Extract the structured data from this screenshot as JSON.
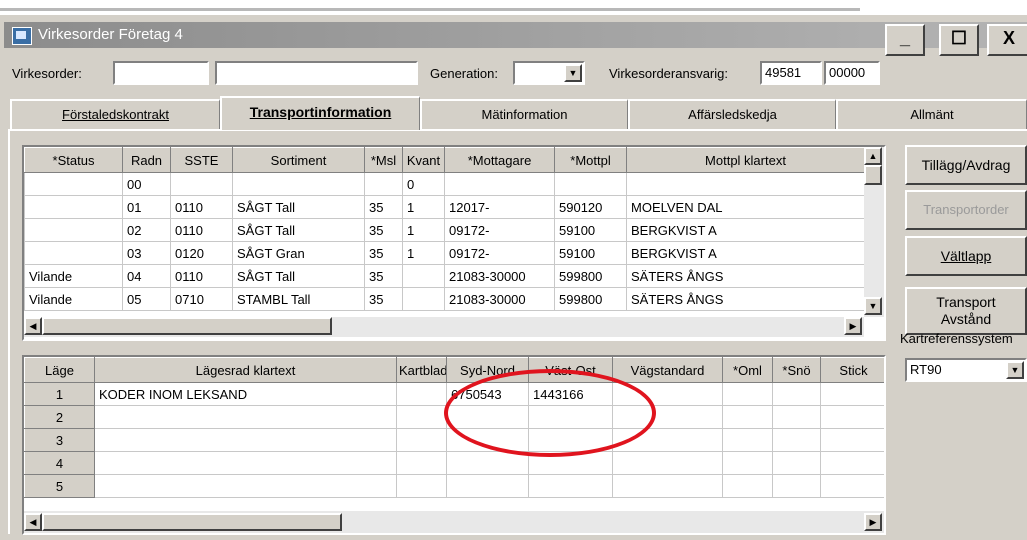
{
  "window": {
    "title": "Virkesorder Företag 4",
    "minimize_label": "_",
    "maximize_label": "☐",
    "close_label": "X"
  },
  "header": {
    "virkesorder_label": "Virkesorder:",
    "virkesorder_value1": "",
    "virkesorder_value2": "",
    "generation_label": "Generation:",
    "generation_value": "",
    "ansvarig_label": "Virkesorderansvarig:",
    "ansvarig_value1": "49581",
    "ansvarig_value2": "00000"
  },
  "tabs": [
    {
      "label": "Förstaledskontrakt"
    },
    {
      "label": "Transportinformation"
    },
    {
      "label": "Mätinformation"
    },
    {
      "label": "Affärsledskedja"
    },
    {
      "label": "Allmänt"
    }
  ],
  "upper_table": {
    "columns": [
      "*Status",
      "Radn",
      "SSTE",
      "Sortiment",
      "*Msl",
      "Kvant",
      "*Mottagare",
      "*Mottpl",
      "Mottpl klartext"
    ],
    "rows": [
      [
        "",
        "00",
        "",
        "",
        "",
        "0",
        "",
        "",
        ""
      ],
      [
        "",
        "01",
        "0110",
        "SÅGT Tall",
        "35",
        "1",
        "12017-",
        "590120",
        "MOELVEN DAL"
      ],
      [
        "",
        "02",
        "0110",
        "SÅGT Tall",
        "35",
        "1",
        "09172-",
        "59100",
        "BERGKVIST A"
      ],
      [
        "",
        "03",
        "0120",
        "SÅGT Gran",
        "35",
        "1",
        "09172-",
        "59100",
        "BERGKVIST A"
      ],
      [
        "Vilande",
        "04",
        "0110",
        "SÅGT Tall",
        "35",
        "",
        "21083-30000",
        "599800",
        "SÄTERS ÅNGS"
      ],
      [
        "Vilande",
        "05",
        "0710",
        "STAMBL Tall",
        "35",
        "",
        "21083-30000",
        "599800",
        "SÄTERS ÅNGS"
      ]
    ]
  },
  "lower_table": {
    "columns": [
      "Läge",
      "Lägesrad klartext",
      "Kartblad",
      "Syd-Nord",
      "Väst-Ost",
      "Vägstandard",
      "*Oml",
      "*Snö",
      "Stick"
    ],
    "rows": [
      [
        "1",
        "KODER INOM LEKSAND",
        "",
        "6750543",
        "1443166",
        "",
        "",
        "",
        ""
      ],
      [
        "2",
        "",
        "",
        "",
        "",
        "",
        "",
        "",
        ""
      ],
      [
        "3",
        "",
        "",
        "",
        "",
        "",
        "",
        "",
        ""
      ],
      [
        "4",
        "",
        "",
        "",
        "",
        "",
        "",
        "",
        ""
      ],
      [
        "5",
        "",
        "",
        "",
        "",
        "",
        "",
        "",
        ""
      ]
    ]
  },
  "side_buttons": {
    "tillagg": "Tillägg/Avdrag",
    "transportorder": "Transportorder",
    "valtlapp": "Vältlapp",
    "transport_line1": "Transport",
    "transport_line2": "Avstånd"
  },
  "koordinat": {
    "label": "Kartreferenssystem",
    "value": "RT90"
  },
  "highlight_color": "#e0141e"
}
